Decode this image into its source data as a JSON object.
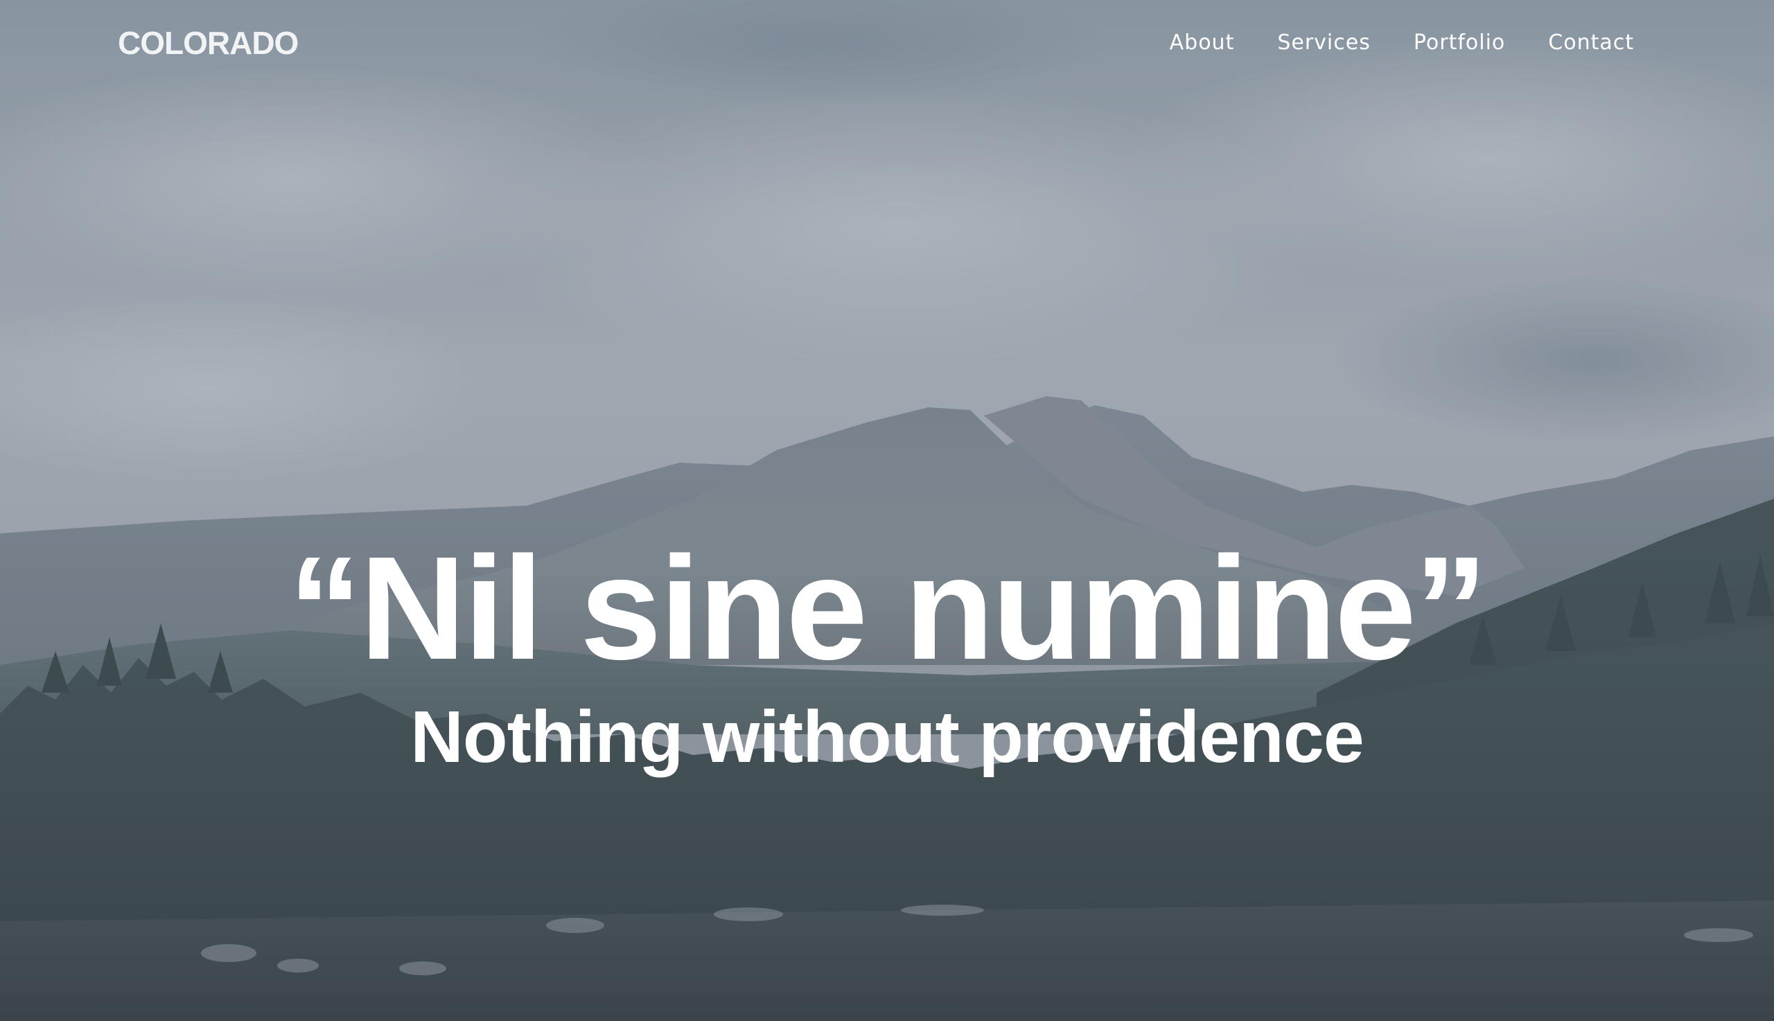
{
  "site": {
    "logo": "COLORADO"
  },
  "nav": {
    "items": [
      {
        "label": "About"
      },
      {
        "label": "Services"
      },
      {
        "label": "Portfolio"
      },
      {
        "label": "Contact"
      }
    ]
  },
  "hero": {
    "quote": "“Nil sine numine”",
    "translation": "Nothing without providence",
    "overlay_color": "#7e8c99"
  }
}
